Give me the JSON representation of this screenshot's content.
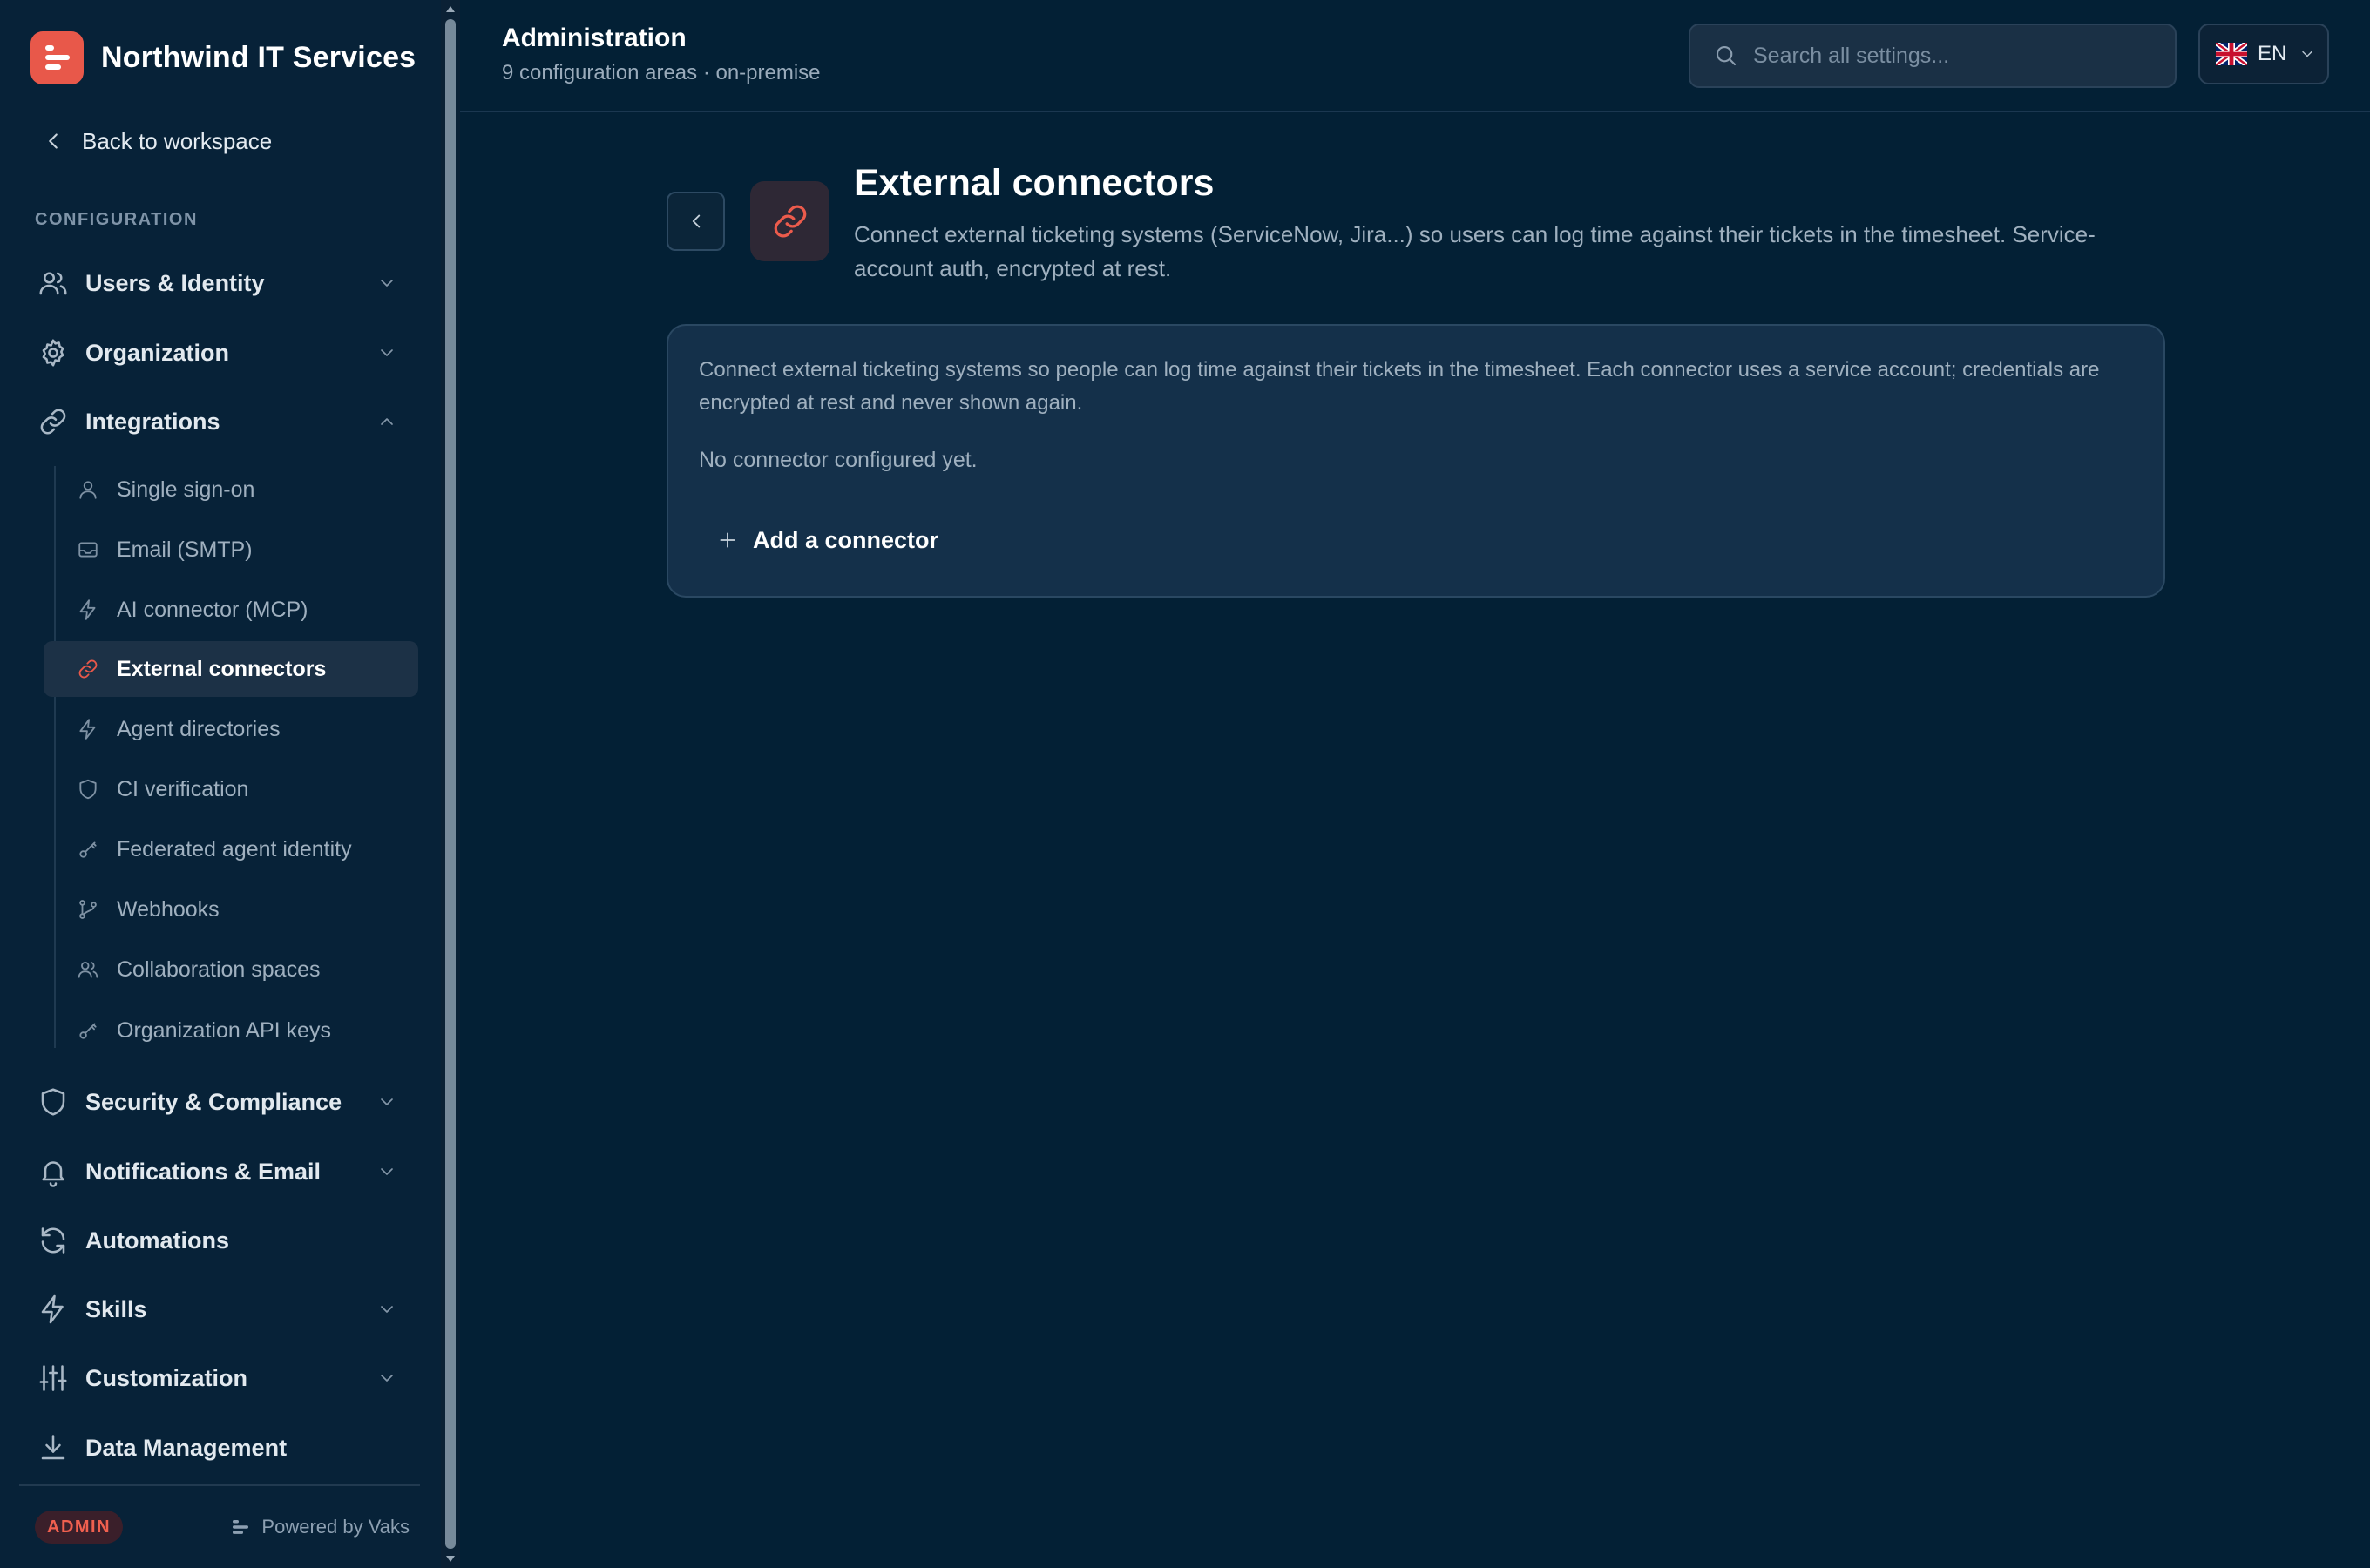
{
  "app": {
    "name": "Northwind IT Services"
  },
  "sidebar": {
    "back_label": "Back to workspace",
    "section_label": "CONFIGURATION",
    "items": [
      {
        "label": "Users & Identity",
        "icon": "users-icon"
      },
      {
        "label": "Organization",
        "icon": "gear-icon"
      },
      {
        "label": "Integrations",
        "icon": "link-icon",
        "expanded": true
      },
      {
        "label": "Security & Compliance",
        "icon": "shield-icon"
      },
      {
        "label": "Notifications & Email",
        "icon": "bell-icon"
      },
      {
        "label": "Automations",
        "icon": "refresh-icon"
      },
      {
        "label": "Skills",
        "icon": "bolt-icon"
      },
      {
        "label": "Customization",
        "icon": "sliders-icon"
      },
      {
        "label": "Data Management",
        "icon": "download-icon"
      }
    ],
    "sub_items": [
      {
        "label": "Single sign-on",
        "icon": "user-icon"
      },
      {
        "label": "Email (SMTP)",
        "icon": "inbox-icon"
      },
      {
        "label": "AI connector (MCP)",
        "icon": "bolt-icon"
      },
      {
        "label": "External connectors",
        "icon": "link-icon",
        "active": true
      },
      {
        "label": "Agent directories",
        "icon": "bolt-icon"
      },
      {
        "label": "CI verification",
        "icon": "shield-icon"
      },
      {
        "label": "Federated agent identity",
        "icon": "key-icon"
      },
      {
        "label": "Webhooks",
        "icon": "git-branch-icon"
      },
      {
        "label": "Collaboration spaces",
        "icon": "users-icon"
      },
      {
        "label": "Organization API keys",
        "icon": "key-icon"
      }
    ],
    "footer": {
      "role_badge": "ADMIN",
      "powered_by": "Powered by Vaks"
    }
  },
  "header": {
    "title": "Administration",
    "subtitle": "9 configuration areas · on-premise",
    "search_placeholder": "Search all settings...",
    "language": "EN"
  },
  "main": {
    "title": "External connectors",
    "description": "Connect external ticketing systems (ServiceNow, Jira...) so users can log time against their tickets in the timesheet. Service-account auth, encrypted at rest.",
    "card": {
      "intro": "Connect external ticketing systems so people can log time against their tickets in the timesheet. Each connector uses a service account; credentials are encrypted at rest and never shown again.",
      "empty_state": "No connector configured yet.",
      "add_label": "Add a connector"
    }
  },
  "colors": {
    "background": "#032035",
    "sidebar": "#072238",
    "accent": "#e8584a",
    "card": "#14304a"
  }
}
